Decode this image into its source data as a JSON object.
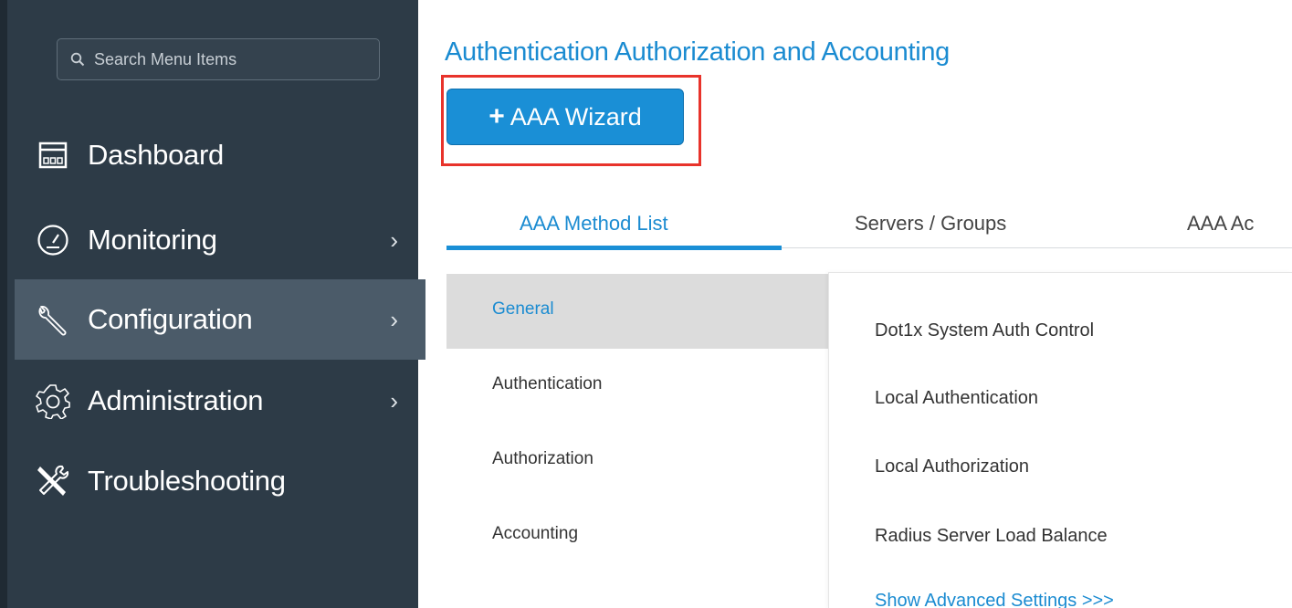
{
  "sidebar": {
    "search": {
      "placeholder": "Search Menu Items"
    },
    "items": [
      {
        "label": "Dashboard",
        "icon": "dashboard-icon",
        "has_chevron": false
      },
      {
        "label": "Monitoring",
        "icon": "gauge-icon",
        "has_chevron": true
      },
      {
        "label": "Configuration",
        "icon": "wrench-icon",
        "has_chevron": true,
        "active": true
      },
      {
        "label": "Administration",
        "icon": "gear-icon",
        "has_chevron": true
      },
      {
        "label": "Troubleshooting",
        "icon": "tools-icon",
        "has_chevron": false
      }
    ],
    "chevron": "›"
  },
  "main": {
    "title": "Authentication Authorization and Accounting",
    "wizard_button": {
      "plus": "+",
      "label": "AAA Wizard"
    },
    "tabs": [
      {
        "label": "AAA Method List",
        "active": true
      },
      {
        "label": "Servers / Groups"
      },
      {
        "label": "AAA Ac"
      }
    ],
    "subnav": [
      {
        "label": "General",
        "active": true
      },
      {
        "label": "Authentication"
      },
      {
        "label": "Authorization"
      },
      {
        "label": "Accounting"
      }
    ],
    "panel": {
      "rows": [
        "Dot1x System Auth Control",
        "Local Authentication",
        "Local Authorization",
        "Radius Server Load Balance"
      ],
      "advanced_link": "Show Advanced Settings >>>"
    }
  },
  "colors": {
    "accent": "#1a8bd1",
    "sidebar_bg": "#2d3b47",
    "sidebar_active": "#4b5b69",
    "highlight_box": "#e8332b"
  }
}
